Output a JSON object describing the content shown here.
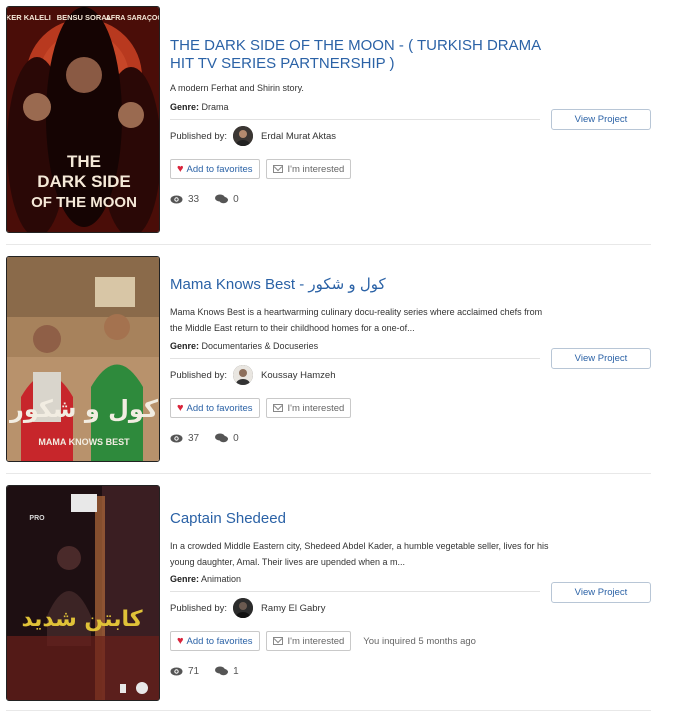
{
  "projects": [
    {
      "title": "THE DARK SIDE OF THE MOON - ( TURKISH DRAMA HIT TV SERIES PARTNERSHIP )",
      "description": "A modern Ferhat and Shirin story.",
      "genre_label": "Genre:",
      "genre": "Drama",
      "published_label": "Published by:",
      "publisher": "Erdal Murat Aktas",
      "favorite_label": "Add to favorites",
      "interested_label": "I'm interested",
      "inquiry_status": "",
      "views": "33",
      "comments": "0",
      "view_button": "View Project",
      "poster": {
        "actors": [
          "ILKER KALELI",
          "BENSU SORAL",
          "AFRA SARAÇOĞLU"
        ],
        "title_lines": [
          "THE",
          "DARK SIDE",
          "OF THE MOON"
        ],
        "colors": {
          "bg": "#5a0f0a",
          "moon": "#c8442a"
        }
      }
    },
    {
      "title": "Mama Knows Best - كول و شكور",
      "description": "Mama Knows Best is a heartwarming culinary docu-reality series where acclaimed chefs from the Middle East return to their childhood homes for a one-of...",
      "genre_label": "Genre:",
      "genre": "Documentaries & Docuseries",
      "published_label": "Published by:",
      "publisher": "Koussay Hamzeh",
      "favorite_label": "Add to favorites",
      "interested_label": "I'm interested",
      "inquiry_status": "",
      "views": "37",
      "comments": "0",
      "view_button": "View Project",
      "poster": {
        "arabic_title": "كول و شكور",
        "subtitle": "MAMA KNOWS BEST",
        "colors": {
          "bg": "#c9a27a",
          "accent": "#d8282e"
        }
      }
    },
    {
      "title": "Captain Shedeed",
      "description": "In a crowded Middle Eastern city, Shedeed Abdel Kader, a humble vegetable seller, lives for his young daughter, Amal. Their lives are upended when a m...",
      "genre_label": "Genre:",
      "genre": "Animation",
      "published_label": "Published by:",
      "publisher": "Ramy El Gabry",
      "favorite_label": "Add to favorites",
      "interested_label": "I'm interested",
      "inquiry_status": "You inquired 5 months ago",
      "views": "71",
      "comments": "1",
      "view_button": "View Project",
      "poster": {
        "arabic_title": "كابتن شديد",
        "badge": "PRO",
        "colors": {
          "bg": "#2a1418",
          "accent": "#e0c238"
        }
      }
    }
  ],
  "icons": {
    "heart": "heart-icon",
    "mail": "envelope-icon",
    "eye": "eye-icon",
    "comments": "comments-icon"
  },
  "colors": {
    "link": "#2b62a6",
    "heart": "#d9243b"
  }
}
